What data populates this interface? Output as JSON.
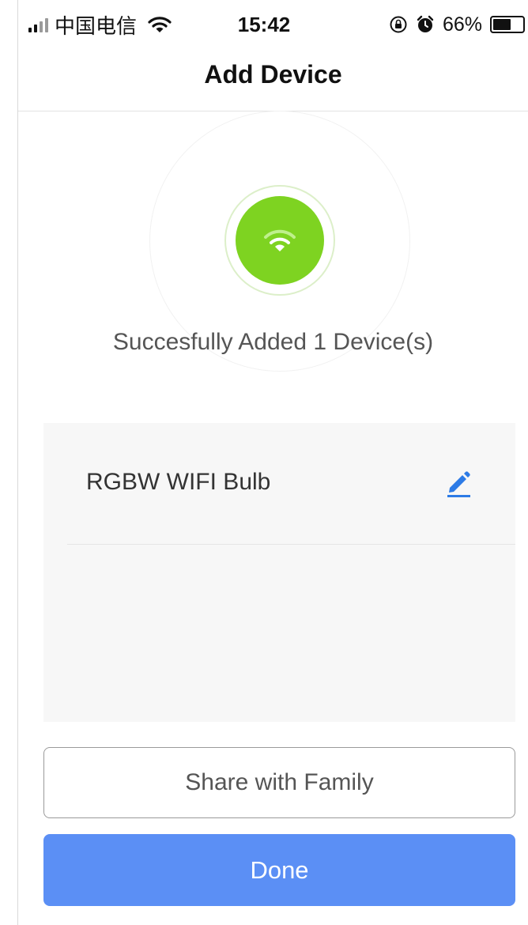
{
  "status_bar": {
    "carrier": "中国电信",
    "time": "15:42",
    "battery_percent": "66%",
    "battery_level": 0.66,
    "icons": [
      "signal-icon",
      "wifi-icon",
      "orientation-lock-icon",
      "alarm-icon",
      "battery-icon"
    ]
  },
  "nav": {
    "title": "Add Device"
  },
  "hero": {
    "message": "Succesfully Added 1 Device(s)",
    "icon": "wifi-icon",
    "accent_color": "#7ed321"
  },
  "devices": [
    {
      "name": "RGBW WIFI Bulb",
      "edit_icon": "pencil-icon"
    }
  ],
  "actions": {
    "share_label": "Share with Family",
    "done_label": "Done",
    "done_color": "#5b8ff5"
  }
}
